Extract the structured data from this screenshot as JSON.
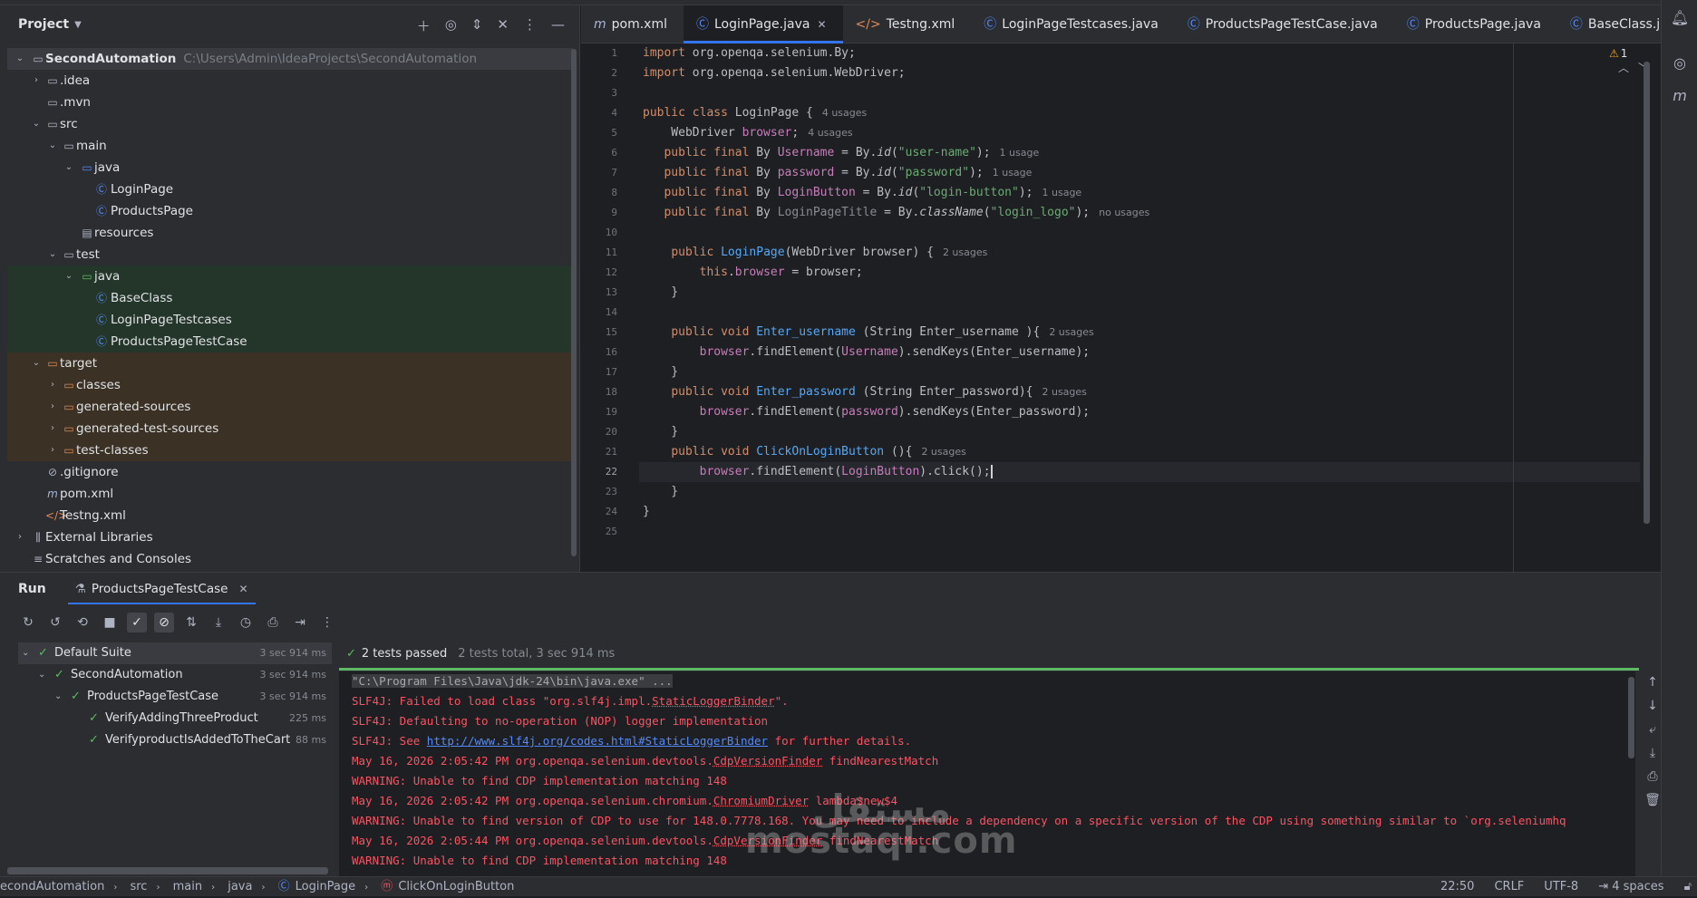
{
  "project": {
    "title": "Project",
    "tree": [
      {
        "label": "SecondAutomation",
        "path": "C:\\Users\\Admin\\IdeaProjects\\SecondAutomation"
      },
      {
        "label": ".idea"
      },
      {
        "label": ".mvn"
      },
      {
        "label": "src"
      },
      {
        "label": "main"
      },
      {
        "label": "java"
      },
      {
        "label": "LoginPage"
      },
      {
        "label": "ProductsPage"
      },
      {
        "label": "resources"
      },
      {
        "label": "test"
      },
      {
        "label": "java"
      },
      {
        "label": "BaseClass"
      },
      {
        "label": "LoginPageTestcases"
      },
      {
        "label": "ProductsPageTestCase"
      },
      {
        "label": "target"
      },
      {
        "label": "classes"
      },
      {
        "label": "generated-sources"
      },
      {
        "label": "generated-test-sources"
      },
      {
        "label": "test-classes"
      },
      {
        "label": ".gitignore"
      },
      {
        "label": "pom.xml"
      },
      {
        "label": "Testng.xml"
      },
      {
        "label": "External Libraries"
      },
      {
        "label": "Scratches and Consoles"
      }
    ]
  },
  "tabs": [
    "pom.xml",
    "LoginPage.java",
    "Testng.xml",
    "LoginPageTestcases.java",
    "ProductsPageTestCase.java",
    "ProductsPage.java",
    "BaseClass.java"
  ],
  "editor": {
    "warnings": "1",
    "line_numbers": [
      "1",
      "2",
      "3",
      "4",
      "5",
      "6",
      "7",
      "8",
      "9",
      "10",
      "11",
      "12",
      "13",
      "14",
      "15",
      "16",
      "17",
      "18",
      "19",
      "20",
      "21",
      "22",
      "23",
      "24",
      "25"
    ],
    "current_line": "22",
    "hints": {
      "h4": "4 usages",
      "h5": "4 usages",
      "h6": "1 usage",
      "h7": "1 usage",
      "h8": "1 usage",
      "h9": "no usages",
      "h11": "2 usages",
      "h15": "2 usages",
      "h18": "2 usages",
      "h21": "2 usages"
    }
  },
  "run": {
    "title": "Run",
    "tab": "ProductsPageTestCase",
    "status": "2 tests passed",
    "status_sub": "2 tests total, 3 sec 914 ms",
    "tests": [
      {
        "name": "Default Suite",
        "time": "3 sec 914 ms"
      },
      {
        "name": "SecondAutomation",
        "time": "3 sec 914 ms"
      },
      {
        "name": "ProductsPageTestCase",
        "time": "3 sec 914 ms"
      },
      {
        "name": "VerifyAddingThreeProduct",
        "time": "225 ms"
      },
      {
        "name": "VerifyproductIsAddedToTheCart",
        "time": "88 ms"
      }
    ],
    "console": {
      "l0": "\"C:\\Program Files\\Java\\jdk-24\\bin\\java.exe\" ...",
      "l1a": "SLF4J: Failed to load class \"org.slf4j.impl.",
      "l1b": "StaticLoggerBinder",
      "l1c": "\".",
      "l2": "SLF4J: Defaulting to no-operation (NOP) logger implementation",
      "l3a": "SLF4J: See ",
      "l3link": "http://www.slf4j.org/codes.html#StaticLoggerBinder",
      "l3c": " for further details.",
      "l4a": "May 16, 2026 2:05:42 PM org.openqa.selenium.devtools.",
      "l4b": "CdpVersionFinder",
      "l4c": " findNearestMatch",
      "l5": "WARNING: Unable to find CDP implementation matching 148",
      "l6a": "May 16, 2026 2:05:42 PM org.openqa.selenium.chromium.",
      "l6b": "ChromiumDriver",
      "l6c": " lambda$new$4",
      "l7": "WARNING: Unable to find version of CDP to use for 148.0.7778.168. You may need to include a dependency on a specific version of the CDP using something similar to `org.seleniumhq",
      "l8a": "May 16, 2026 2:05:44 PM org.openqa.selenium.devtools.",
      "l8b": "CdpVersionFinder",
      "l8c": " findNearestMatch",
      "l9": "WARNING: Unable to find CDP implementation matching 148"
    }
  },
  "watermark": {
    "ar": "مستقل",
    "en": "mostaql.com"
  },
  "status_bar": {
    "crumbs": [
      "econdAutomation",
      "src",
      "main",
      "java",
      "LoginPage",
      "ClickOnLoginButton"
    ],
    "position": "22:50",
    "line_sep": "CRLF",
    "encoding": "UTF-8",
    "indent": "4 spaces"
  }
}
